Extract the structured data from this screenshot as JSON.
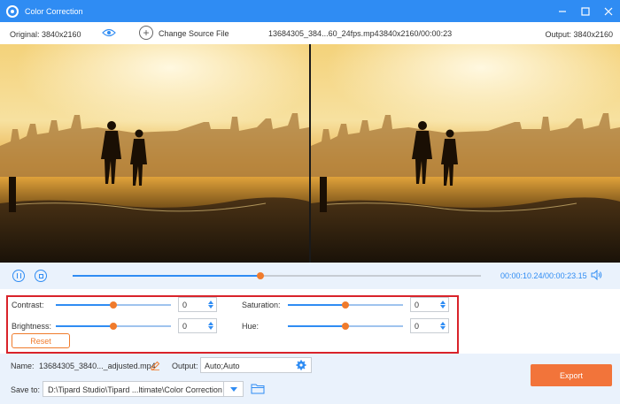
{
  "window": {
    "title": "Color Correction"
  },
  "infobar": {
    "original_label": "Original: 3840x2160",
    "change_source_label": "Change Source File",
    "file_name": "13684305_384...60_24fps.mp4",
    "file_meta": "3840x2160/00:00:23",
    "output_label": "Output: 3840x2160"
  },
  "playback": {
    "current_time": "00:00:10.24",
    "total_time": "/00:00:23.15",
    "progress": 0.46
  },
  "adjustments": {
    "contrast": {
      "label": "Contrast:",
      "value": "0",
      "level": 0.5
    },
    "saturation": {
      "label": "Saturation:",
      "value": "0",
      "level": 0.5
    },
    "brightness": {
      "label": "Brightness:",
      "value": "0",
      "level": 0.5
    },
    "hue": {
      "label": "Hue:",
      "value": "0",
      "level": 0.5
    },
    "reset_label": "Reset"
  },
  "bottom": {
    "name_label": "Name:",
    "name_value": "13684305_3840..._adjusted.mp4",
    "output_label": "Output:",
    "output_value": "Auto;Auto",
    "saveto_label": "Save to:",
    "saveto_value": "D:\\Tipard Studio\\Tipard ...ltimate\\Color Correction",
    "export_label": "Export"
  },
  "colors": {
    "accent": "#2f8cf3",
    "knob": "#f07b2c",
    "highlight_frame": "#d9232a",
    "export": "#f2743a"
  }
}
